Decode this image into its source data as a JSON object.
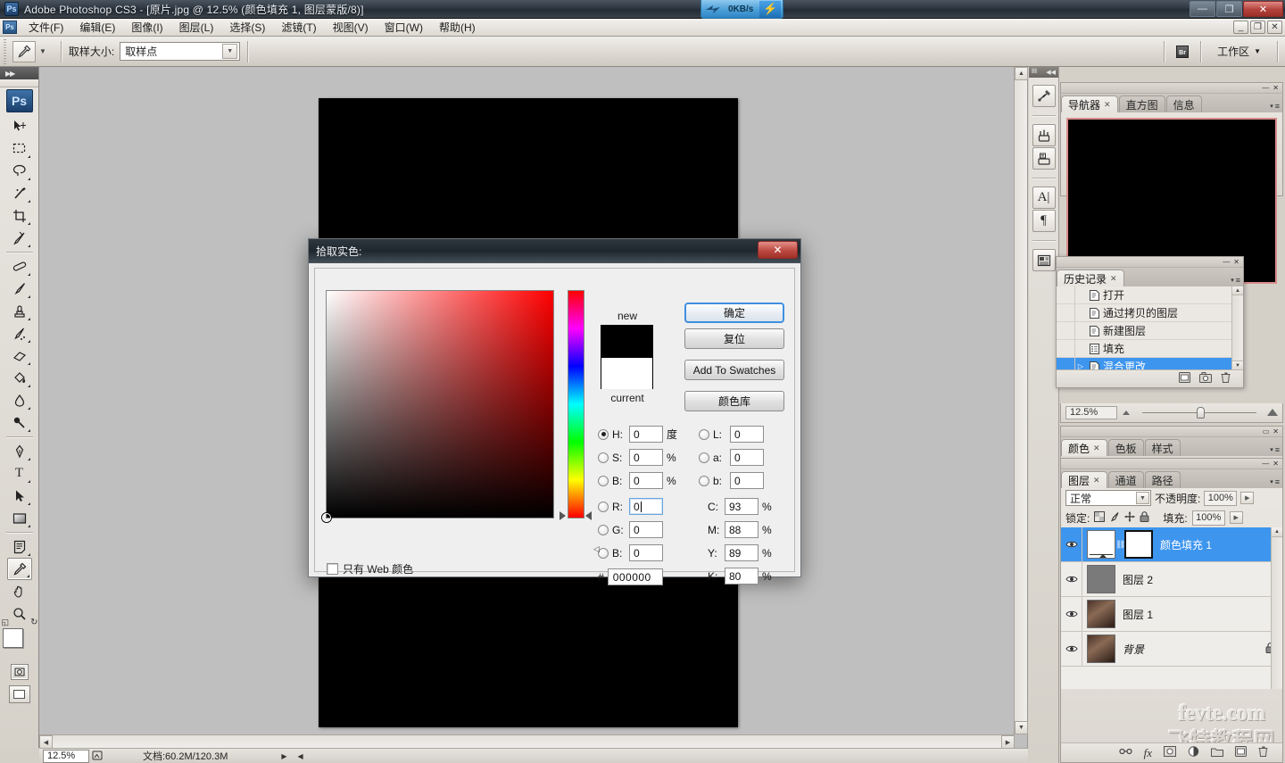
{
  "window": {
    "title": "Adobe Photoshop CS3 - [原片.jpg @ 12.5% (颜色填充 1, 图层蒙版/8)]",
    "app_badge": "Ps",
    "minimize": "—",
    "maximize": "❐",
    "close": "✕"
  },
  "network_widget": {
    "bird_icon": "network-bird-icon",
    "speed": "0KB/s",
    "bolt": "⚡"
  },
  "menubar": {
    "doc_badge": "Ps",
    "items": [
      {
        "label": "文件(F)"
      },
      {
        "label": "编辑(E)"
      },
      {
        "label": "图像(I)"
      },
      {
        "label": "图层(L)"
      },
      {
        "label": "选择(S)"
      },
      {
        "label": "滤镜(T)"
      },
      {
        "label": "视图(V)"
      },
      {
        "label": "窗口(W)"
      },
      {
        "label": "帮助(H)"
      }
    ],
    "mdi_minimize": "_",
    "mdi_restore": "❐",
    "mdi_close": "✕"
  },
  "options_bar": {
    "tool_icon": "eyedropper-icon",
    "tool_caret": "▼",
    "sample_size_label": "取样大小:",
    "sample_size_value": "取样点",
    "sample_size_arrow": "▼",
    "bridge_badge": "Br",
    "workspace_label": "工作区",
    "workspace_caret": "▼"
  },
  "toolbox": {
    "logo": "Ps",
    "tools": [
      {
        "name": "move-tool",
        "glyph": "✥",
        "sub": false,
        "selected": false
      },
      {
        "name": "marquee-tool",
        "glyph": "▭",
        "sub": true,
        "selected": false
      },
      {
        "name": "lasso-tool",
        "glyph": "◠",
        "sub": true,
        "selected": false
      },
      {
        "name": "magic-wand-tool",
        "glyph": "✎",
        "sub": true,
        "selected": false
      },
      {
        "name": "crop-tool",
        "glyph": "✂",
        "sub": true,
        "selected": false
      },
      {
        "name": "slice-tool",
        "glyph": "✐",
        "sub": true,
        "selected": false
      },
      {
        "name": "healing-brush-tool",
        "glyph": "⌁",
        "sub": true,
        "selected": false
      },
      {
        "name": "brush-tool",
        "glyph": "✑",
        "sub": true,
        "selected": false
      },
      {
        "name": "clone-stamp-tool",
        "glyph": "⊕",
        "sub": true,
        "selected": false
      },
      {
        "name": "history-brush-tool",
        "glyph": "✒",
        "sub": true,
        "selected": false
      },
      {
        "name": "eraser-tool",
        "glyph": "◣",
        "sub": true,
        "selected": false
      },
      {
        "name": "paint-bucket-tool",
        "glyph": "◥",
        "sub": true,
        "selected": false
      },
      {
        "name": "blur-tool",
        "glyph": "💧",
        "sub": true,
        "selected": false
      },
      {
        "name": "dodge-tool",
        "glyph": "🔍",
        "sub": true,
        "selected": false
      },
      {
        "name": "pen-tool",
        "glyph": "✎",
        "sub": true,
        "selected": false
      },
      {
        "name": "type-tool",
        "glyph": "T",
        "sub": true,
        "selected": false
      },
      {
        "name": "path-selection-tool",
        "glyph": "➤",
        "sub": true,
        "selected": false
      },
      {
        "name": "shape-tool",
        "glyph": "▢",
        "sub": true,
        "selected": false
      },
      {
        "name": "notes-tool",
        "glyph": "▤",
        "sub": true,
        "selected": false
      },
      {
        "name": "eyedropper-tool",
        "glyph": "⚲",
        "sub": false,
        "selected": true
      },
      {
        "name": "hand-tool",
        "glyph": "✋",
        "sub": false,
        "selected": false
      },
      {
        "name": "zoom-tool",
        "glyph": "🔎",
        "sub": false,
        "selected": false
      }
    ],
    "foreground_color": "#ffffff",
    "background_color": "#000000",
    "swap_icon": "↻",
    "default_icon": "◱",
    "quickmask_standard": "◯",
    "quickmask_mask": "◑",
    "screenmode": "▢"
  },
  "document": {
    "canvas_color": "#000000",
    "background_color": "#bfbfbf"
  },
  "status_bar": {
    "zoom": "12.5%",
    "preview_icon": "doc-icon",
    "doc_info": "文档:60.2M/120.3M",
    "arrow": "▶",
    "arrow2": "◀"
  },
  "icon_dock": {
    "buttons": [
      {
        "name": "tool-presets-icon",
        "glyph": "✂"
      },
      {
        "name": "brushes-icon",
        "glyph": "🖌"
      },
      {
        "name": "clone-source-icon",
        "glyph": "⎙"
      },
      {
        "name": "character-icon",
        "glyph": "A"
      },
      {
        "name": "paragraph-icon",
        "glyph": "¶"
      },
      {
        "name": "layer-comps-icon",
        "glyph": "▤"
      }
    ]
  },
  "navigator_panel": {
    "tabs": [
      {
        "label": "导航器",
        "active": true,
        "closable": true
      },
      {
        "label": "直方图",
        "active": false,
        "closable": false
      },
      {
        "label": "信息",
        "active": false,
        "closable": false
      }
    ],
    "menu_icon": "≡",
    "collapse_icon": "—",
    "close_icon": "✕",
    "zoom_value": "12.5%",
    "zoom_out_icon": "zoom-out-icon",
    "zoom_in_icon": "zoom-in-icon",
    "thumb_color": "#000000",
    "view_box_color": "#d98b8b"
  },
  "history_panel": {
    "tabs": [
      {
        "label": "历史记录",
        "active": true,
        "closable": true
      }
    ],
    "menu_icon": "≡",
    "collapse_icon": "—",
    "close_icon": "✕",
    "items": [
      {
        "label": "打开",
        "icon": "history-state-icon",
        "selected": false,
        "current": false
      },
      {
        "label": "通过拷贝的图层",
        "icon": "history-state-icon",
        "selected": false,
        "current": false
      },
      {
        "label": "新建图层",
        "icon": "history-state-icon",
        "selected": false,
        "current": false
      },
      {
        "label": "填充",
        "icon": "history-fill-icon",
        "selected": false,
        "current": false
      },
      {
        "label": "混合更改",
        "icon": "history-state-icon",
        "selected": true,
        "current": true
      }
    ],
    "footer_icons": [
      {
        "name": "new-document-from-state-icon",
        "glyph": "▣"
      },
      {
        "name": "new-snapshot-icon",
        "glyph": "📷"
      },
      {
        "name": "delete-state-icon",
        "glyph": "🗑"
      }
    ]
  },
  "color_panel": {
    "tabs": [
      {
        "label": "颜色",
        "active": true,
        "closable": true
      },
      {
        "label": "色板",
        "active": false,
        "closable": false
      },
      {
        "label": "样式",
        "active": false,
        "closable": false
      }
    ],
    "menu_icon": "≡",
    "collapse_icon": "▭",
    "close_icon": "✕"
  },
  "layers_panel": {
    "tabs": [
      {
        "label": "图层",
        "active": true,
        "closable": true
      },
      {
        "label": "通道",
        "active": false,
        "closable": false
      },
      {
        "label": "路径",
        "active": false,
        "closable": false
      }
    ],
    "menu_icon": "≡",
    "collapse_icon": "—",
    "close_icon": "✕",
    "blend_mode": "正常",
    "blend_arrow": "▼",
    "opacity_label": "不透明度:",
    "opacity_value": "100%",
    "opacity_arrow": "▶",
    "lock_label": "锁定:",
    "lock_icons": [
      {
        "name": "lock-transparency-icon",
        "glyph": "▨"
      },
      {
        "name": "lock-image-icon",
        "glyph": "✎"
      },
      {
        "name": "lock-position-icon",
        "glyph": "✥"
      },
      {
        "name": "lock-all-icon",
        "glyph": "🔒"
      }
    ],
    "fill_label": "填充:",
    "fill_value": "100%",
    "fill_arrow": "▶",
    "layers": [
      {
        "name": "颜色填充 1",
        "selected": true,
        "visible": true,
        "eye": "👁",
        "kind": "fill-with-mask",
        "locked": false,
        "link_icon": "⛓"
      },
      {
        "name": "图层 2",
        "selected": false,
        "visible": true,
        "eye": "👁",
        "kind": "gray",
        "locked": false
      },
      {
        "name": "图层 1",
        "selected": false,
        "visible": true,
        "eye": "👁",
        "kind": "photo",
        "locked": false
      },
      {
        "name": "背景",
        "selected": false,
        "visible": true,
        "eye": "👁",
        "kind": "photo",
        "locked": true,
        "lock_glyph": "🔒"
      }
    ],
    "footer_icons": [
      {
        "name": "link-layers-icon",
        "glyph": "⛓"
      },
      {
        "name": "layer-style-icon",
        "glyph": "fx"
      },
      {
        "name": "add-layer-mask-icon",
        "glyph": "◱"
      },
      {
        "name": "adjustment-layer-icon",
        "glyph": "◑"
      },
      {
        "name": "new-group-icon",
        "glyph": "▭"
      },
      {
        "name": "new-layer-icon",
        "glyph": "▣"
      },
      {
        "name": "delete-layer-icon",
        "glyph": "🗑"
      }
    ]
  },
  "watermark": {
    "line1": "fevte.com",
    "line2": "飞特教程网"
  },
  "color_picker": {
    "title": "拾取实色:",
    "close_label": "✕",
    "buttons": {
      "ok": "确定",
      "reset": "复位",
      "add_to_swatches": "Add To Swatches",
      "color_libraries": "颜色库"
    },
    "preview": {
      "new_label": "new",
      "current_label": "current",
      "new_color": "#000000",
      "current_color": "#ffffff"
    },
    "web_only_label": "只有 Web 颜色",
    "web_only_checked": false,
    "hue_value": 0,
    "hsb": [
      {
        "key": "H",
        "label": "H:",
        "value": "0",
        "unit": "度",
        "selected": true
      },
      {
        "key": "S",
        "label": "S:",
        "value": "0",
        "unit": "%",
        "selected": false
      },
      {
        "key": "B",
        "label": "B:",
        "value": "0",
        "unit": "%",
        "selected": false
      }
    ],
    "lab": [
      {
        "key": "L",
        "label": "L:",
        "value": "0",
        "unit": "",
        "selected": false
      },
      {
        "key": "a",
        "label": "a:",
        "value": "0",
        "unit": "",
        "selected": false
      },
      {
        "key": "b",
        "label": "b:",
        "value": "0",
        "unit": "",
        "selected": false
      }
    ],
    "rgb": [
      {
        "key": "R",
        "label": "R:",
        "value": "0",
        "unit": "",
        "selected": false,
        "focused": true
      },
      {
        "key": "G",
        "label": "G:",
        "value": "0",
        "unit": "",
        "selected": false,
        "focused": false
      },
      {
        "key": "B",
        "label": "B:",
        "value": "0",
        "unit": "",
        "selected": false,
        "focused": false
      }
    ],
    "cmyk": [
      {
        "key": "C",
        "label": "C:",
        "value": "93",
        "unit": "%"
      },
      {
        "key": "M",
        "label": "M:",
        "value": "88",
        "unit": "%"
      },
      {
        "key": "Y",
        "label": "Y:",
        "value": "89",
        "unit": "%"
      },
      {
        "key": "K",
        "label": "K:",
        "value": "80",
        "unit": "%"
      }
    ],
    "hex_prefix": "#",
    "hex_value": "000000"
  }
}
